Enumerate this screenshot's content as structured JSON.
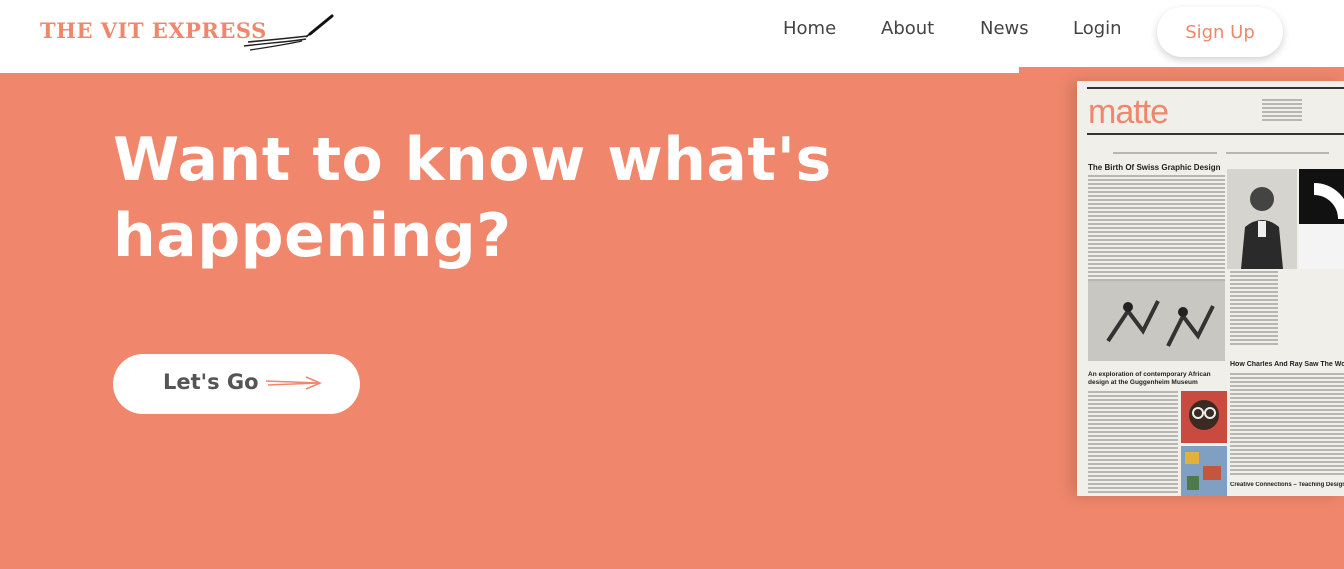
{
  "brand": {
    "name": "THE VIT EXPRESS",
    "accent_color": "#f0876c",
    "logo_icon": "pen-icon"
  },
  "nav": {
    "items": [
      {
        "label": "Home"
      },
      {
        "label": "About"
      },
      {
        "label": "News"
      },
      {
        "label": "Login"
      }
    ],
    "signup_label": "Sign Up"
  },
  "hero": {
    "headline": "Want to know what's happening?",
    "cta_label": "Let's Go",
    "cta_icon": "arrow-right-icon",
    "background_color": "#f0876c"
  },
  "newspaper": {
    "masthead": "matte",
    "headline_1": "The Birth Of Swiss Graphic Design",
    "headline_2": "How Charles And Ray Saw The World",
    "headline_3": "An exploration of contemporary African design at the Guggenheim Museum",
    "headline_4": "Creative Connections – Teaching Design To F"
  }
}
